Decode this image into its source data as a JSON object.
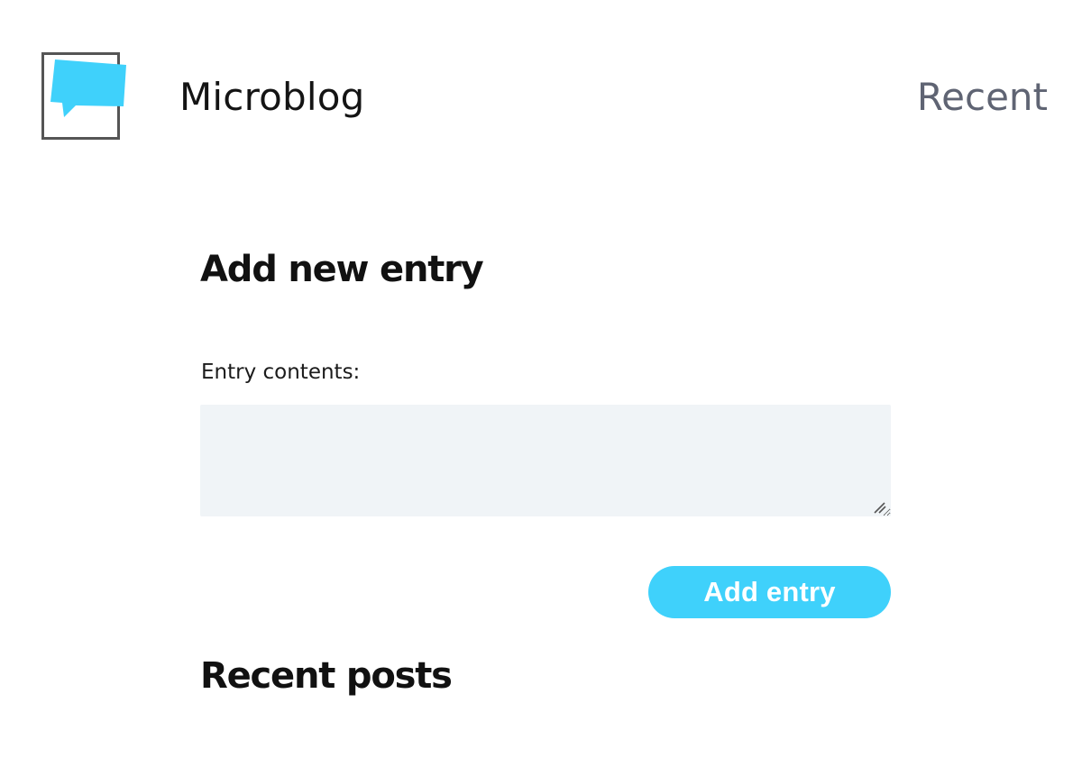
{
  "header": {
    "brand": "Microblog",
    "nav_recent": "Recent",
    "logo_icon": "speech-bubble-logo"
  },
  "main": {
    "new_entry_title": "Add new entry",
    "entry_label": "Entry contents:",
    "entry_value": "",
    "entry_placeholder": "",
    "add_button_label": "Add entry",
    "recent_title": "Recent posts"
  },
  "colors": {
    "accent": "#3FD1FB",
    "textarea_bg": "#F0F4F7",
    "nav_text": "#5F6473",
    "logo_border": "#555555"
  }
}
